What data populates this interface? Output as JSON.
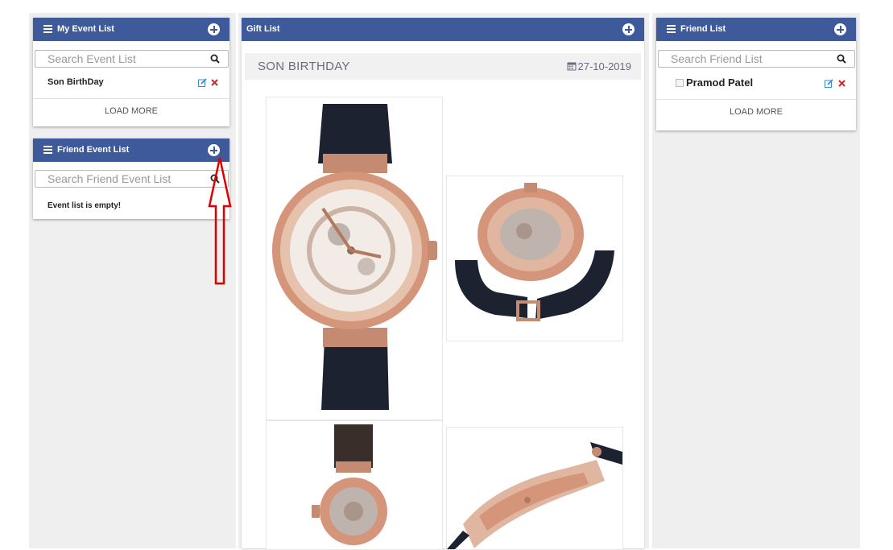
{
  "my_event_list": {
    "title": "My Event List",
    "search_placeholder": "Search Event List",
    "items": [
      {
        "label": "Son BirthDay"
      }
    ],
    "load_more_label": "LOAD MORE"
  },
  "friend_event_list": {
    "title": "Friend Event List",
    "search_placeholder": "Search Friend Event List",
    "empty_message": "Event list is empty!"
  },
  "gift_list": {
    "title": "Gift List",
    "event_name": "SON BIRTHDAY",
    "event_date": "27-10-2019",
    "gifts": [
      {
        "image": "watch-front"
      },
      {
        "image": "watch-back"
      },
      {
        "image": "watch-back-closeup"
      },
      {
        "image": "watch-side"
      }
    ]
  },
  "friend_list": {
    "title": "Friend List",
    "search_placeholder": "Search Friend List",
    "items": [
      {
        "label": "Pramod Patel"
      }
    ],
    "load_more_label": "LOAD MORE"
  },
  "colors": {
    "header_bg": "#3f5a9a",
    "edit_icon": "#3a8fd0",
    "delete_icon": "#e02020",
    "annotation_arrow": "#e00000",
    "watch_gold": "#d4957a",
    "strap": "#1d2231"
  },
  "icons": {
    "menu": "menu-icon",
    "add": "plus-circle-icon",
    "search": "search-icon",
    "edit": "edit-icon",
    "delete": "close-icon",
    "calendar": "calendar-icon",
    "checkbox": "checkbox-icon"
  }
}
